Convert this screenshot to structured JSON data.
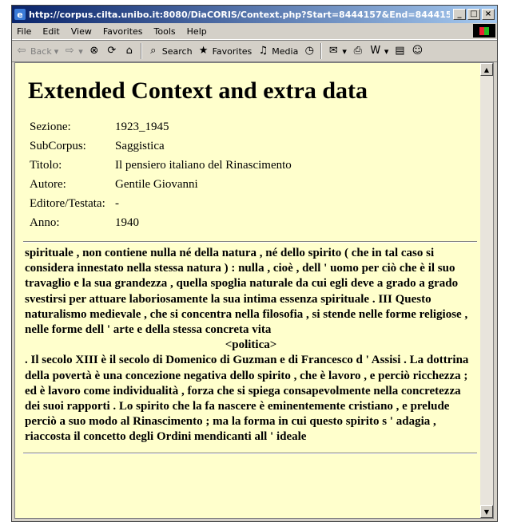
{
  "window": {
    "title": "http://corpus.cilta.unibo.it:8080/DiaCORIS/Context.php?Start=8444157&End=844415...",
    "minimize": "_",
    "maximize": "□",
    "close": "×"
  },
  "menu": [
    "File",
    "Edit",
    "View",
    "Favorites",
    "Tools",
    "Help"
  ],
  "toolbar": {
    "back": "Back",
    "search": "Search",
    "favorites": "Favorites",
    "media": "Media"
  },
  "page": {
    "heading": "Extended Context and extra data",
    "metadata": [
      {
        "label": "Sezione:",
        "value": "1923_1945"
      },
      {
        "label": "SubCorpus:",
        "value": "Saggistica"
      },
      {
        "label": "Titolo:",
        "value": "Il pensiero italiano del Rinascimento"
      },
      {
        "label": "Autore:",
        "value": "Gentile Giovanni"
      },
      {
        "label": "Editore/Testata:",
        "value": "-"
      },
      {
        "label": "Anno:",
        "value": "1940"
      }
    ],
    "context_before": "spirituale , non contiene nulla né della natura , né dello spirito ( che in tal caso si considera innestato nella stessa natura ) : nulla , cioè , dell ' uomo per ciò che è il suo travaglio e la sua grandezza , quella spoglia naturale da cui egli deve a grado a grado svestirsi per attuare laboriosamente la sua intima essenza spirituale . III Questo naturalismo medievale , che si concentra nella filosofia , si stende nelle forme religiose , nelle forme dell ' arte e della stessa concreta vita",
    "tag": "<politica>",
    "context_after": ". Il secolo XIII è il secolo di Domenico di Guzman e di Francesco d ' Assisi . La dottrina della povertà è una concezione negativa dello spirito , che è lavoro , e perciò ricchezza ; ed è lavoro come individualità , forza che si spiega consapevolmente nella concretezza dei suoi rapporti . Lo spirito che la fa nascere è eminentemente cristiano , e prelude perciò a suo modo al Rinascimento ; ma la forma in cui questo spirito s ' adagia , riaccosta il concetto degli Ordini mendicanti all ' ideale"
  }
}
